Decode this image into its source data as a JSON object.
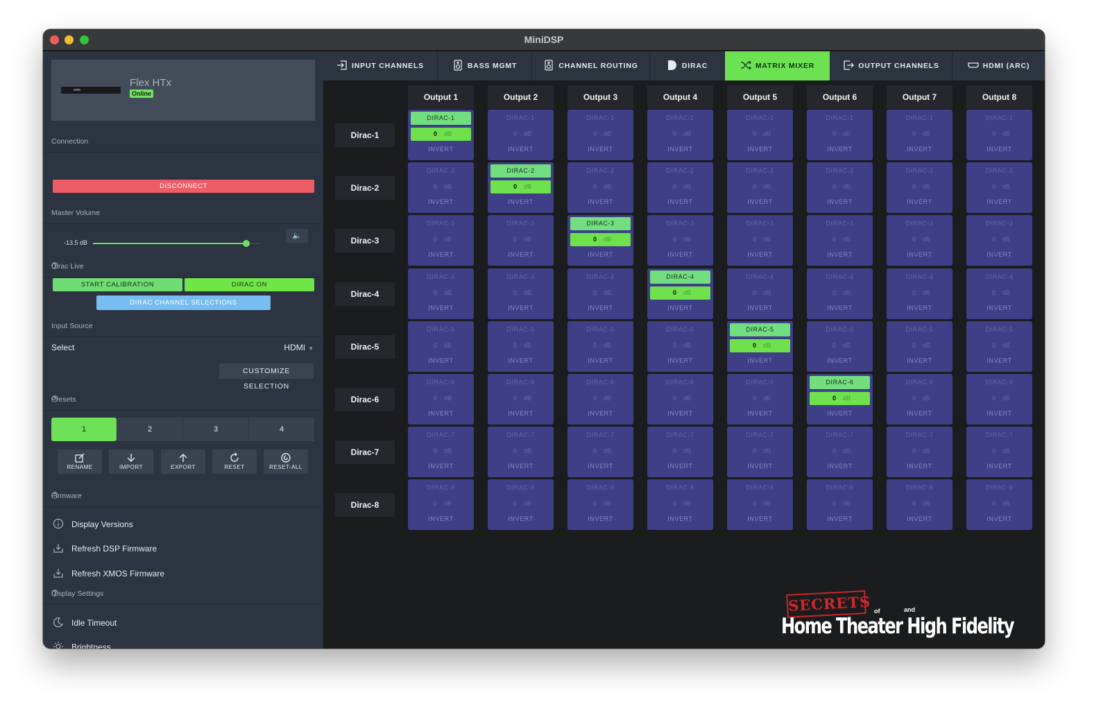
{
  "window": {
    "title": "MiniDSP"
  },
  "device": {
    "name": "Flex HTx",
    "status": "Online"
  },
  "sections": {
    "connection": "Connection",
    "master_volume": "Master Volume",
    "dirac_live": "Dirac Live",
    "input_source": "Input Source",
    "presets": "Presets",
    "firmware": "Firmware",
    "display_settings": "Display Settings"
  },
  "connection": {
    "disconnect_label": "DISCONNECT"
  },
  "volume": {
    "value_text": "-13.5 dB",
    "level": 0.92
  },
  "dirac": {
    "start_calibration": "START CALIBRATION",
    "dirac_on": "DIRAC ON",
    "channel_selections": "DIRAC CHANNEL SELECTIONS"
  },
  "input_source": {
    "select_label": "Select",
    "value": "HDMI",
    "customize": "CUSTOMIZE SELECTION"
  },
  "presets": {
    "items": [
      "1",
      "2",
      "3",
      "4"
    ],
    "active": 0
  },
  "preset_actions": [
    {
      "label": "RENAME",
      "icon": "rename-icon"
    },
    {
      "label": "IMPORT",
      "icon": "import-icon"
    },
    {
      "label": "EXPORT",
      "icon": "export-icon"
    },
    {
      "label": "RESET",
      "icon": "reset-icon"
    },
    {
      "label": "RESET-ALL",
      "icon": "reset-all-icon"
    }
  ],
  "firmware_items": [
    {
      "label": "Display Versions",
      "icon": "info-icon"
    },
    {
      "label": "Refresh DSP Firmware",
      "icon": "download-icon"
    },
    {
      "label": "Refresh XMOS Firmware",
      "icon": "download-icon"
    }
  ],
  "display_items": [
    {
      "label": "Idle Timeout",
      "icon": "moon-icon"
    },
    {
      "label": "Brightness",
      "icon": "sun-icon"
    }
  ],
  "tabs": [
    {
      "label": "INPUT CHANNELS",
      "icon": "input-icon"
    },
    {
      "label": "BASS MGMT",
      "icon": "speaker-icon"
    },
    {
      "label": "CHANNEL ROUTING",
      "icon": "speaker-icon"
    },
    {
      "label": "DIRAC",
      "icon": "dirac-icon"
    },
    {
      "label": "MATRIX MIXER",
      "icon": "shuffle-icon"
    },
    {
      "label": "OUTPUT CHANNELS",
      "icon": "output-icon"
    },
    {
      "label": "HDMI (ARC)",
      "icon": "hdmi-icon"
    }
  ],
  "active_tab": 4,
  "matrix": {
    "outputs": [
      "Output 1",
      "Output 2",
      "Output 3",
      "Output 4",
      "Output 5",
      "Output 6",
      "Output 7",
      "Output 8"
    ],
    "inputs": [
      "Dirac-1",
      "Dirac-2",
      "Dirac-3",
      "Dirac-4",
      "Dirac-5",
      "Dirac-6",
      "Dirac-7",
      "Dirac-8"
    ],
    "cell_names": [
      "DIRAC-1",
      "DIRAC-2",
      "DIRAC-3",
      "DIRAC-4",
      "DIRAC-5",
      "DIRAC-6",
      "DIRAC-7",
      "DIRAC-8"
    ],
    "gain_value": "0",
    "gain_unit": "dB",
    "invert_label": "INVERT",
    "enabled": [
      [
        0,
        0
      ],
      [
        1,
        1
      ],
      [
        2,
        2
      ],
      [
        3,
        3
      ],
      [
        4,
        4
      ],
      [
        5,
        5
      ]
    ]
  },
  "watermark": {
    "secrets": "SECRETS",
    "of": "of",
    "and": "and",
    "main": "Home Theater High Fidelity"
  },
  "colors": {
    "accent_green": "#6ce253",
    "disconnect_red": "#ee5d66",
    "blue": "#76bdf1",
    "cell_blue": "#3e3f87"
  }
}
